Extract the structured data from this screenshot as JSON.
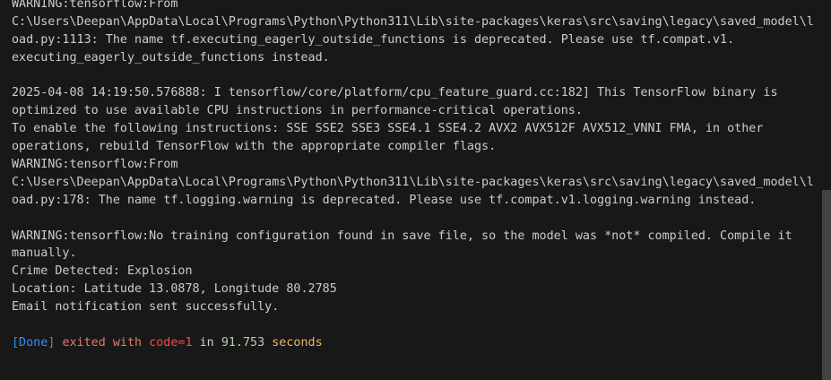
{
  "terminal": {
    "lines": [
      "WARNING:tensorflow:From",
      "C:\\Users\\Deepan\\AppData\\Local\\Programs\\Python\\Python311\\Lib\\site-packages\\keras\\src\\saving\\legacy\\saved_model\\l",
      "oad.py:1113: The name tf.executing_eagerly_outside_functions is deprecated. Please use tf.compat.v1.",
      "executing_eagerly_outside_functions instead.",
      "",
      "2025-04-08 14:19:50.576888: I tensorflow/core/platform/cpu_feature_guard.cc:182] This TensorFlow binary is",
      "optimized to use available CPU instructions in performance-critical operations.",
      "To enable the following instructions: SSE SSE2 SSE3 SSE4.1 SSE4.2 AVX2 AVX512F AVX512_VNNI FMA, in other",
      "operations, rebuild TensorFlow with the appropriate compiler flags.",
      "WARNING:tensorflow:From",
      "C:\\Users\\Deepan\\AppData\\Local\\Programs\\Python\\Python311\\Lib\\site-packages\\keras\\src\\saving\\legacy\\saved_model\\l",
      "oad.py:178: The name tf.logging.warning is deprecated. Please use tf.compat.v1.logging.warning instead.",
      "",
      "WARNING:tensorflow:No training configuration found in save file, so the model was *not* compiled. Compile it",
      "manually.",
      "Crime Detected: Explosion",
      "Location: Latitude 13.0878, Longitude 80.2785",
      "Email notification sent successfully.",
      ""
    ],
    "done": {
      "tag": "[Done]",
      "exited": "exited with",
      "code": "code=1",
      "in": "in",
      "seconds_value": "91.753",
      "seconds_label": "seconds"
    }
  }
}
